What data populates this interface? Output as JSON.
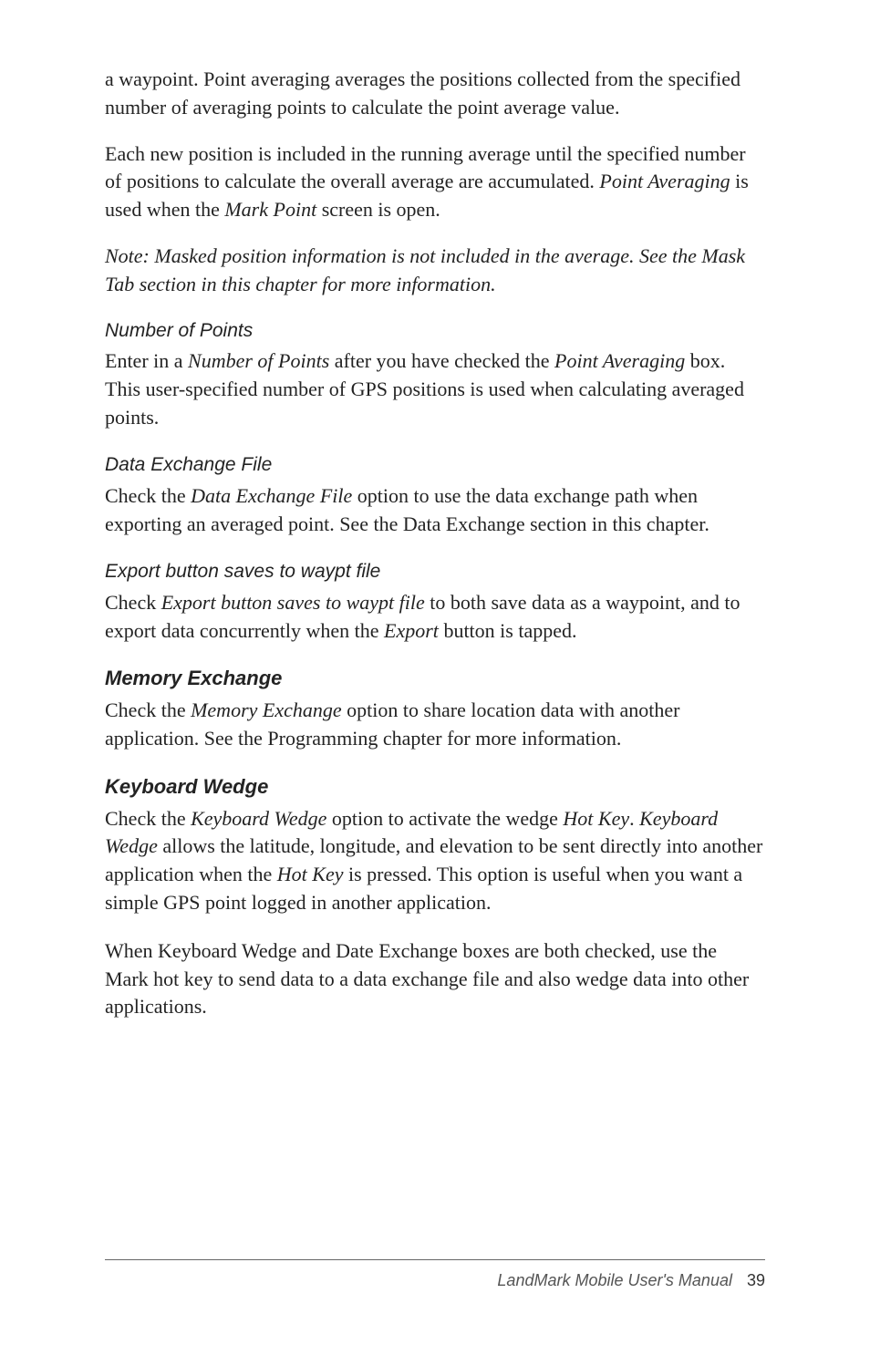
{
  "paragraphs": {
    "p1": "a waypoint. Point averaging averages the positions collected from the specified number of averaging points to calculate the point average value.",
    "p2_pre": "Each new position is included in the running average until the specified number of positions to calculate the overall average are accumulated. ",
    "p2_i1": "Point Averaging",
    "p2_mid": " is used when the ",
    "p2_i2": "Mark Point",
    "p2_post": " screen is open.",
    "p3": "Note: Masked position information is not included in the average. See the Mask Tab section in this chapter for more information.",
    "h_number": "Number of Points",
    "p4_pre": "Enter in a ",
    "p4_i1": "Number of Points",
    "p4_mid": " after you have checked the ",
    "p4_i2": "Point Averaging",
    "p4_post": " box. This user-specified number of GPS positions is used when calculating averaged points.",
    "h_data": "Data Exchange File",
    "p5_pre": "Check the ",
    "p5_i1": "Data Exchange File",
    "p5_post": " option to use the data exchange path when exporting an averaged point. See the Data Exchange section in this chapter.",
    "h_export": "Export button saves to waypt file",
    "p6_pre": "Check ",
    "p6_i1": "Export button saves to waypt file",
    "p6_mid": " to both save data as a waypoint, and to export data concurrently when the ",
    "p6_i2": "Export",
    "p6_post": " button is tapped.",
    "h_memory": "Memory Exchange",
    "p7_pre": "Check the ",
    "p7_i1": "Memory Exchange",
    "p7_post": " option to share location data with another application. See the Programming chapter for more information.",
    "h_keyboard": "Keyboard Wedge",
    "p8_pre": "Check the ",
    "p8_i1": "Keyboard Wedge",
    "p8_mid1": " option to activate the wedge ",
    "p8_i2": "Hot Key",
    "p8_mid2": ". ",
    "p8_i3": "Keyboard Wedge",
    "p8_mid3": " allows the latitude, longitude, and elevation to be sent directly into another application when the ",
    "p8_i4": "Hot Key",
    "p8_post": " is pressed. This option is useful when you want a simple GPS point logged in another application.",
    "p9": "When Keyboard Wedge and Date Exchange boxes are both checked, use the Mark hot key to send data to a data exchange file and also wedge data into other applications."
  },
  "footer": {
    "title": "LandMark Mobile User's Manual",
    "page": "39"
  }
}
